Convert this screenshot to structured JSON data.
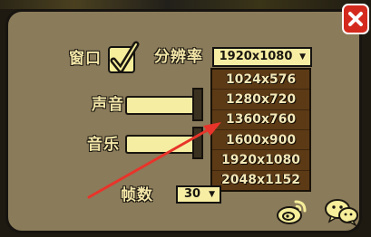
{
  "settings": {
    "window_label": "窗口",
    "window_checked": true,
    "resolution_label": "分辨率",
    "resolution_selected": "1920x1080",
    "resolution_options": [
      "1024x576",
      "1280x720",
      "1360x760",
      "1600x900",
      "1920x1080",
      "2048x1152"
    ],
    "sound_label": "声音",
    "music_label": "音乐",
    "fps_label": "帧数",
    "fps_selected": "30",
    "dropdown_arrow": "▼"
  },
  "icons": {
    "close": "close-icon",
    "check": "checkmark-icon",
    "weibo": "weibo-icon",
    "wechat": "wechat-icon"
  },
  "colors": {
    "panel_bg": "#8a7b5a",
    "label_text": "#f3e6a8",
    "field_bg": "#f7eea4",
    "dropdown_bg": "#5c3a16",
    "close_red": "#d42a1e",
    "annotation_arrow": "#e8342a"
  }
}
